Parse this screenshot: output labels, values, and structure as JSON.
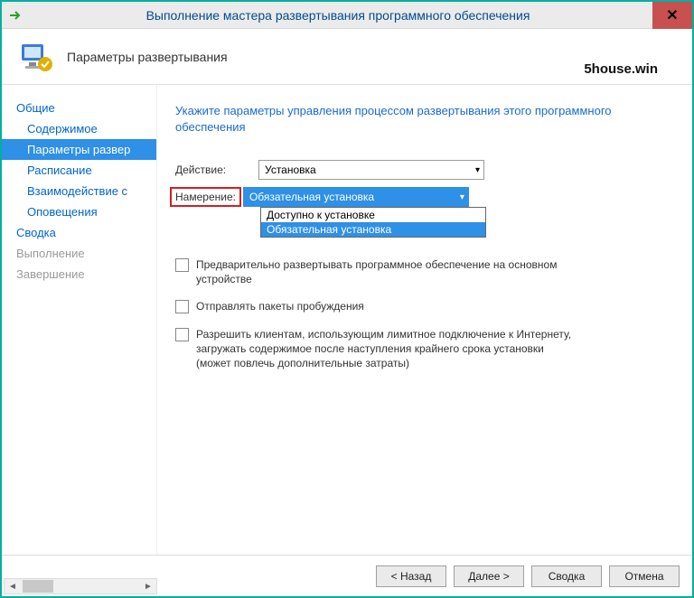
{
  "window": {
    "title": "Выполнение мастера развертывания программного обеспечения",
    "close_glyph": "✕"
  },
  "header": {
    "title": "Параметры развертывания",
    "watermark": "5house.win"
  },
  "sidebar": {
    "items": [
      {
        "label": "Общие",
        "child": false,
        "selected": false,
        "disabled": false
      },
      {
        "label": "Содержимое",
        "child": true,
        "selected": false,
        "disabled": false
      },
      {
        "label": "Параметры развер",
        "child": true,
        "selected": true,
        "disabled": false
      },
      {
        "label": "Расписание",
        "child": true,
        "selected": false,
        "disabled": false
      },
      {
        "label": "Взаимодействие с",
        "child": true,
        "selected": false,
        "disabled": false
      },
      {
        "label": "Оповещения",
        "child": true,
        "selected": false,
        "disabled": false
      },
      {
        "label": "Сводка",
        "child": false,
        "selected": false,
        "disabled": false
      },
      {
        "label": "Выполнение",
        "child": false,
        "selected": false,
        "disabled": true
      },
      {
        "label": "Завершение",
        "child": false,
        "selected": false,
        "disabled": true
      }
    ]
  },
  "content": {
    "instruction": "Укажите параметры управления процессом развертывания этого программного обеспечения",
    "action_label": "Действие:",
    "action_value": "Установка",
    "purpose_label": "Намерение:",
    "purpose_value": "Обязательная установка",
    "purpose_options": [
      "Доступно к установке",
      "Обязательная установка"
    ],
    "checkboxes": [
      "Предварительно развертывать программное обеспечение на основном устройстве",
      "Отправлять пакеты пробуждения",
      "Разрешить клиентам, использующим лимитное подключение к Интернету, загружать содержимое после наступления крайнего срока установки (может повлечь дополнительные затраты)"
    ]
  },
  "footer": {
    "back": "< Назад",
    "next": "Далее >",
    "summary": "Сводка",
    "cancel": "Отмена"
  }
}
